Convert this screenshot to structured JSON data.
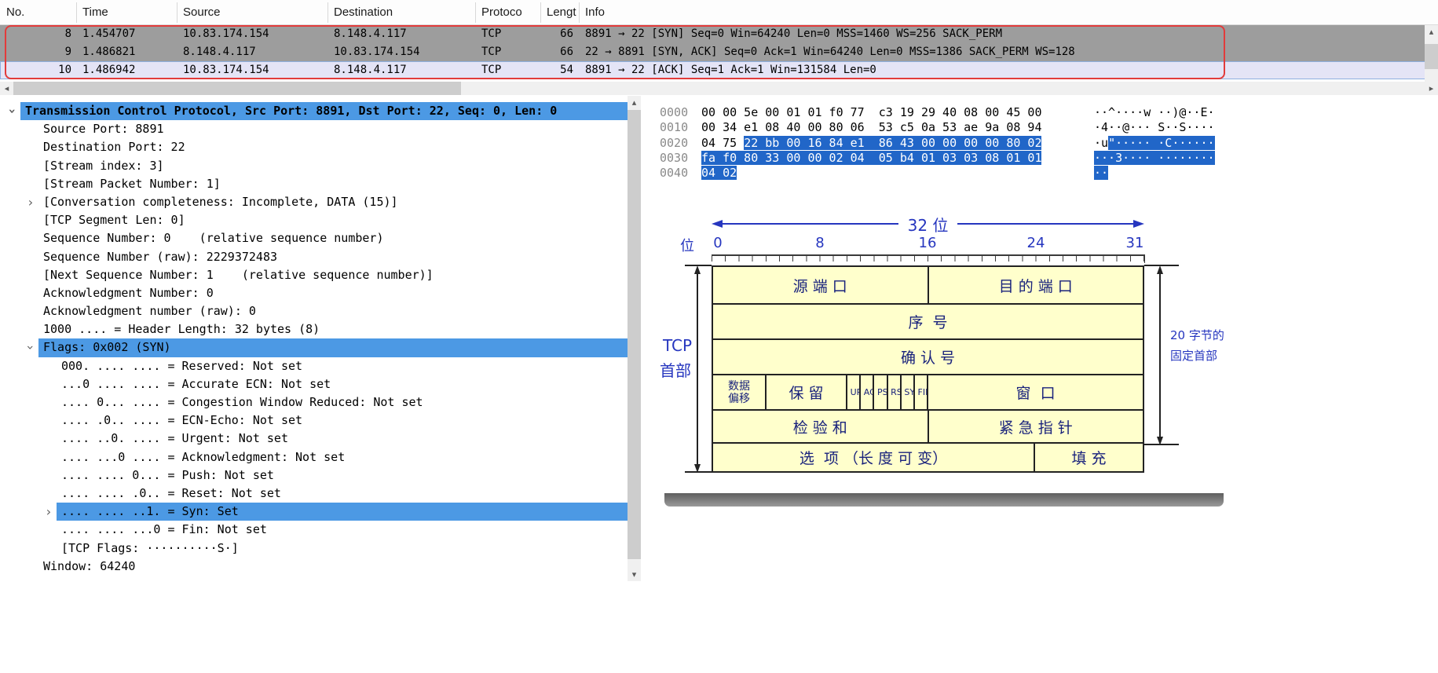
{
  "icons": {
    "scroll_left": "◂",
    "scroll_right": "▸",
    "scroll_up": "▴",
    "scroll_down": "▾",
    "chevron_collapsed": "›",
    "chevron_expanded": "›"
  },
  "colors": {
    "row_gray": "#9d9d9d",
    "row_current": "#e4e4f6",
    "tree_selection_blue": "#4c99e4",
    "hex_selection_blue": "#2166c8",
    "annotation_red": "#e23b3b",
    "diagram_cell_bg": "#ffffcc",
    "diagram_text_navy": "#19227c",
    "diagram_accent_blue": "#2636bf"
  },
  "packet_list": {
    "columns": [
      "No.",
      "Time",
      "Source",
      "Destination",
      "Protoco",
      "Lengt",
      "Info"
    ],
    "rows": [
      {
        "no": "8",
        "time": "1.454707",
        "source": "10.83.174.154",
        "destination": "8.148.4.117",
        "protocol": "TCP",
        "length": "66",
        "info": "8891 → 22 [SYN] Seq=0 Win=64240 Len=0 MSS=1460 WS=256 SACK_PERM"
      },
      {
        "no": "9",
        "time": "1.486821",
        "source": "8.148.4.117",
        "destination": "10.83.174.154",
        "protocol": "TCP",
        "length": "66",
        "info": "22 → 8891 [SYN, ACK] Seq=0 Ack=1 Win=64240 Len=0 MSS=1386 SACK_PERM WS=128"
      },
      {
        "no": "10",
        "time": "1.486942",
        "source": "10.83.174.154",
        "destination": "8.148.4.117",
        "protocol": "TCP",
        "length": "54",
        "info": "8891 → 22 [ACK] Seq=1 Ack=1 Win=131584 Len=0"
      }
    ]
  },
  "detail_tree": {
    "lines": [
      {
        "t": "Transmission Control Protocol, Src Port: 8891, Dst Port: 22, Seq: 0, Len: 0"
      },
      {
        "t": "Source Port: 8891"
      },
      {
        "t": "Destination Port: 22"
      },
      {
        "t": "[Stream index: 3]"
      },
      {
        "t": "[Stream Packet Number: 1]"
      },
      {
        "t": "[Conversation completeness: Incomplete, DATA (15)]"
      },
      {
        "t": "[TCP Segment Len: 0]"
      },
      {
        "t": "Sequence Number: 0    (relative sequence number)"
      },
      {
        "t": "Sequence Number (raw): 2229372483"
      },
      {
        "t": "[Next Sequence Number: 1    (relative sequence number)]"
      },
      {
        "t": "Acknowledgment Number: 0"
      },
      {
        "t": "Acknowledgment number (raw): 0"
      },
      {
        "t": "1000 .... = Header Length: 32 bytes (8)"
      },
      {
        "t": "Flags: 0x002 (SYN)"
      },
      {
        "t": "000. .... .... = Reserved: Not set"
      },
      {
        "t": "...0 .... .... = Accurate ECN: Not set"
      },
      {
        "t": ".... 0... .... = Congestion Window Reduced: Not set"
      },
      {
        "t": ".... .0.. .... = ECN-Echo: Not set"
      },
      {
        "t": ".... ..0. .... = Urgent: Not set"
      },
      {
        "t": ".... ...0 .... = Acknowledgment: Not set"
      },
      {
        "t": ".... .... 0... = Push: Not set"
      },
      {
        "t": ".... .... .0.. = Reset: Not set"
      },
      {
        "t": ".... .... ..1. = Syn: Set"
      },
      {
        "t": ".... .... ...0 = Fin: Not set"
      },
      {
        "t": "[TCP Flags: ··········S·]"
      },
      {
        "t": "Window: 64240"
      }
    ]
  },
  "hex_view": {
    "lines": [
      {
        "offset": "0000",
        "hex": "00 00 5e 00 01 01 f0 77  c3 19 29 40 08 00 45 00",
        "hex_selected": "",
        "ascii": "··^····w ··)@··E·",
        "ascii_selected": ""
      },
      {
        "offset": "0010",
        "hex": "00 34 e1 08 40 00 80 06  53 c5 0a 53 ae 9a 08 94",
        "hex_selected": "",
        "ascii": "·4··@··· S··S····",
        "ascii_selected": ""
      },
      {
        "offset": "0020",
        "hex": "04 75 ",
        "hex_selected": "22 bb 00 16 84 e1  86 43 00 00 00 00 80 02",
        "ascii": "·u",
        "ascii_selected": "\"····· ·C······"
      },
      {
        "offset": "0030",
        "hex": "",
        "hex_selected": "fa f0 80 33 00 00 02 04  05 b4 01 03 03 08 01 01",
        "ascii": "",
        "ascii_selected": "···3···· ········"
      },
      {
        "offset": "0040",
        "hex": "",
        "hex_selected": "04 02",
        "ascii": "",
        "ascii_selected": "··"
      }
    ]
  },
  "diagram": {
    "top_label": "32 位",
    "bit_axis_label": "位",
    "bit_numbers": [
      "0",
      "8",
      "16",
      "24",
      "31"
    ],
    "left_label_line1": "TCP",
    "left_label_line2": "首部",
    "right_label_line1": "20 字节的",
    "right_label_line2": "固定首部",
    "cells": {
      "src_port": "源 端 口",
      "dst_port": "目 的 端 口",
      "seq": "序  号",
      "ack": "确 认 号",
      "data_offset_l1": "数据",
      "data_offset_l2": "偏移",
      "reserved": "保 留",
      "flags": [
        "URG",
        "ACK",
        "PSH",
        "RST",
        "SYN",
        "FIN"
      ],
      "window": "窗  口",
      "checksum": "检 验 和",
      "urgent_ptr": "紧 急 指 针",
      "options": "选  项 （长 度 可 变）",
      "padding": "填 充"
    }
  }
}
